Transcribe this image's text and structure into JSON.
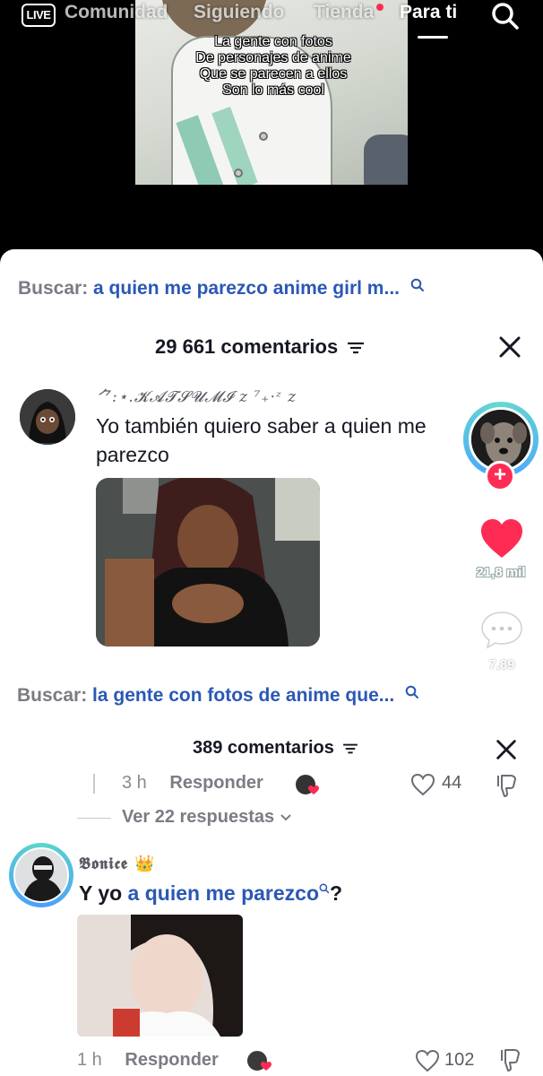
{
  "top_nav": {
    "live_label": "LIVE",
    "tabs": [
      "Comunidad",
      "Siguiendo",
      "Tienda",
      "Para ti"
    ],
    "active_tab": "Para ti"
  },
  "video": {
    "caption_lines": [
      "La gente con fotos",
      "De personajes de anime",
      "Que se parecen a ellos",
      "Son lo más cool"
    ]
  },
  "sheet1": {
    "search_label": "Buscar:",
    "search_query": "a quien me parezco anime girl m...",
    "comment_count": "29 661 comentarios",
    "comment": {
      "username": "⺈:⋆.𝓚𝓐𝓣𝓢𝓤𝓜𝓘 z ⁷₊⋅ᶻ z",
      "text": "Yo también quiero saber a quien me parezco"
    },
    "rail": {
      "like_count": "21,8 mil",
      "comment_count": "7,89"
    }
  },
  "sheet2": {
    "search_label": "Buscar:",
    "search_query": "la gente con fotos de anime que...",
    "comment_count": "389 comentarios",
    "prev_comment": {
      "time": "3 h",
      "respond_label": "Responder",
      "likes": "44"
    },
    "view_replies": "Ver 22 respuestas",
    "comment": {
      "username": "𝕭𝖔𝖓𝖎𝖈𝖊 👑",
      "text_prefix": "Y yo ",
      "text_link": "a quien me parezco",
      "text_suffix": "?",
      "time": "1 h",
      "respond_label": "Responder",
      "likes": "102"
    }
  },
  "colors": {
    "accent_red": "#fe2c55",
    "link_blue": "#2a58b5",
    "grey_text": "#7a7b83"
  }
}
